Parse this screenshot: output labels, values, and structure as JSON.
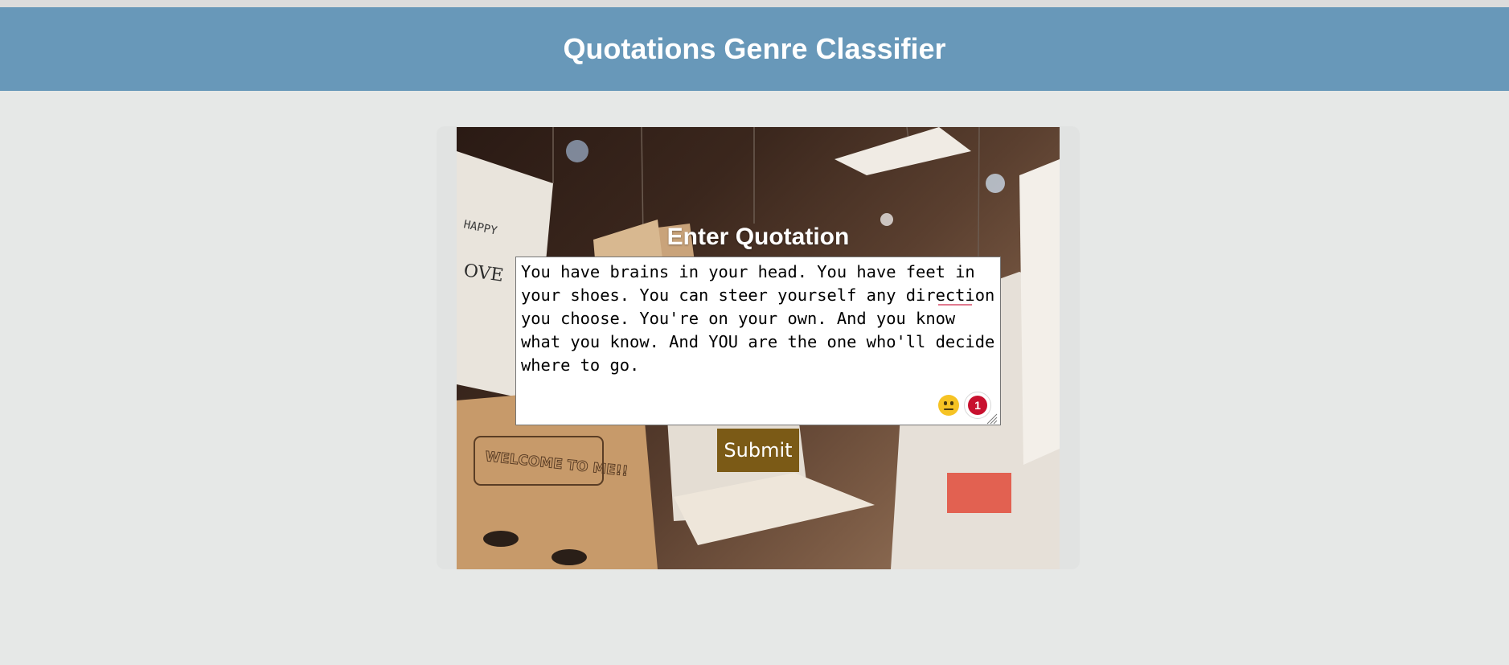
{
  "header": {
    "title": "Quotations Genre Classifier"
  },
  "form": {
    "title": "Enter Quotation",
    "quote_value": "You have brains in your head. You have feet in your shoes. You can steer yourself any direction you choose. You're on your own. And you know what you know. And YOU are the one who'll decide where to go.",
    "grammar_issue_count": "1",
    "submit_label": "Submit"
  },
  "background_photo": {
    "signs": [
      "HAPPY",
      "OVE",
      "WELCOME TO ME!!"
    ]
  },
  "colors": {
    "header_bg": "#6898b9",
    "page_bg": "#e6e8e7",
    "submit_bg": "#7b5a16",
    "badge": "#c8102e"
  },
  "icons": [
    "neutral-face-emoji-icon",
    "grammar-issue-badge-icon",
    "resize-handle-icon"
  ]
}
